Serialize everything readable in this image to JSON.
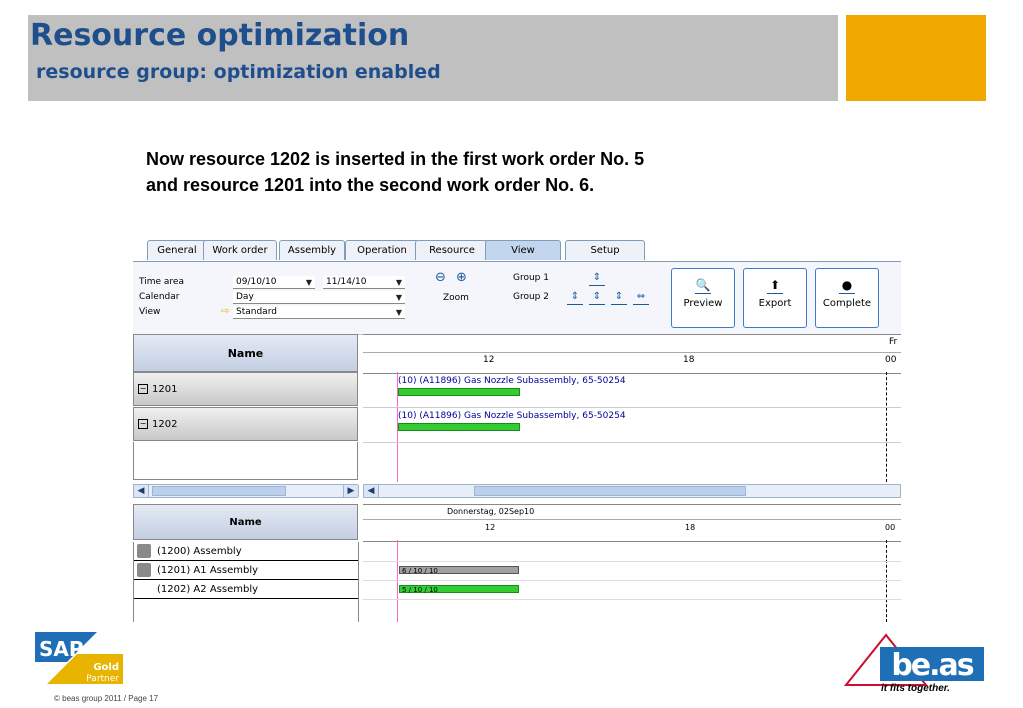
{
  "slide": {
    "title": "Resource optimization",
    "subtitle": "resource group: optimization enabled",
    "description_lines": [
      "Now resource 1202 is inserted in the first work order No. 5",
      "and  resource 1201 into the second work order No. 6."
    ],
    "accent_color": "#f0a800",
    "title_color": "#1f4e8c",
    "copyright": "© beas group 2011 / Page 17"
  },
  "tabs": [
    {
      "label": "General"
    },
    {
      "label": "Work order"
    },
    {
      "label": "Assembly"
    },
    {
      "label": "Operation"
    },
    {
      "label": "Resource"
    },
    {
      "label": "View",
      "active": true
    },
    {
      "label": "Setup"
    }
  ],
  "filters": {
    "time_area_label": "Time area",
    "time_from": "09/10/10",
    "time_to": "11/14/10",
    "calendar_label": "Calendar",
    "calendar_value": "Day",
    "view_label": "View",
    "view_value": "Standard"
  },
  "zoom": {
    "label": "Zoom"
  },
  "groups": {
    "group1": "Group 1",
    "group2": "Group 2"
  },
  "buttons": {
    "preview": "Preview",
    "export": "Export",
    "complete": "Complete"
  },
  "upper_gantt": {
    "name_header": "Name",
    "ticks": [
      "12",
      "18",
      "00"
    ],
    "day_marker": "Fr",
    "resources": [
      {
        "name": "1201",
        "task": "(10) (A11896) Gas Nozzle Subassembly, 65-50254"
      },
      {
        "name": "1202",
        "task": "(10) (A11896) Gas Nozzle Subassembly, 65-50254"
      }
    ]
  },
  "lower_gantt": {
    "name_header": "Name",
    "date_label": "Donnerstag, 02Sep10",
    "ticks": [
      "12",
      "18",
      "00"
    ],
    "rows": [
      {
        "name": "(1200) Assembly",
        "bar_label": ""
      },
      {
        "name": "(1201) A1 Assembly",
        "bar_label": "6 / 10 / 10"
      },
      {
        "name": "(1202) A2 Assembly",
        "bar_label": "5 / 10 / 10"
      }
    ]
  },
  "logos": {
    "sap_text": "SAP",
    "sap_badge_line1": "Gold",
    "sap_badge_line2": "Partner",
    "beas_text": "be.as",
    "beas_tagline": "it fits together."
  }
}
